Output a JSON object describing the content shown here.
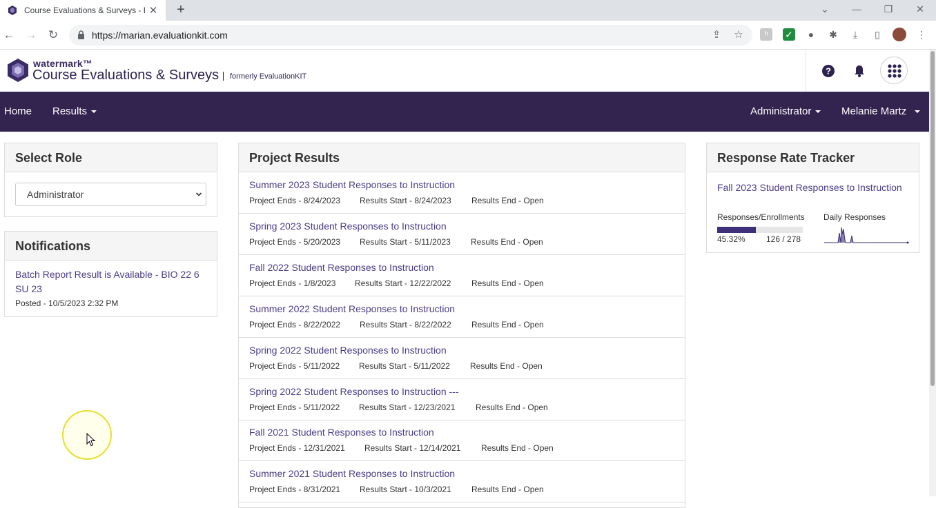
{
  "browser": {
    "tab_title": "Course Evaluations & Surveys - E",
    "tab_close": "✕",
    "new_tab": "+",
    "url": "https://marian.evaluationkit.com"
  },
  "header": {
    "brand_small": "watermark™",
    "brand_big": "Course Evaluations & Surveys",
    "formerly": "formerly EvaluationKIT"
  },
  "nav": {
    "home": "Home",
    "results": "Results",
    "administrator": "Administrator",
    "user": "Melanie Martz"
  },
  "select_role": {
    "title": "Select Role",
    "selected": "Administrator"
  },
  "notifications": {
    "title": "Notifications",
    "items": [
      {
        "link": "Batch Report Result is Available - BIO 22 6 SU 23",
        "posted": "Posted - 10/5/2023 2:32 PM"
      }
    ]
  },
  "project_results": {
    "title": "Project Results",
    "rows": [
      {
        "title": "Summer 2023 Student Responses to Instruction",
        "ends": "Project Ends - 8/24/2023",
        "start": "Results Start - 8/24/2023",
        "end": "Results End - Open"
      },
      {
        "title": "Spring 2023 Student Responses to Instruction",
        "ends": "Project Ends - 5/20/2023",
        "start": "Results Start - 5/11/2023",
        "end": "Results End - Open"
      },
      {
        "title": "Fall 2022 Student Responses to Instruction",
        "ends": "Project Ends - 1/8/2023",
        "start": "Results Start - 12/22/2022",
        "end": "Results End - Open"
      },
      {
        "title": "Summer 2022 Student Responses to Instruction",
        "ends": "Project Ends - 8/22/2022",
        "start": "Results Start - 8/22/2022",
        "end": "Results End - Open"
      },
      {
        "title": "Spring 2022 Student Responses to Instruction",
        "ends": "Project Ends - 5/11/2022",
        "start": "Results Start - 5/11/2022",
        "end": "Results End - Open"
      },
      {
        "title": "Spring 2022 Student Responses to Instruction ---",
        "ends": "Project Ends - 5/11/2022",
        "start": "Results Start - 12/23/2021",
        "end": "Results End - Open"
      },
      {
        "title": "Fall 2021 Student Responses to Instruction",
        "ends": "Project Ends - 12/31/2021",
        "start": "Results Start - 12/14/2021",
        "end": "Results End - Open"
      },
      {
        "title": "Summer 2021 Student Responses to Instruction",
        "ends": "Project Ends - 8/31/2021",
        "start": "Results Start - 10/3/2021",
        "end": "Results End - Open"
      }
    ]
  },
  "response_rate": {
    "title": "Response Rate Tracker",
    "project": "Fall 2023 Student Responses to Instruction",
    "label_enrollments": "Responses/Enrollments",
    "label_daily": "Daily Responses",
    "percent": "45.32%",
    "fraction": 0.4532,
    "counts": "126 / 278"
  },
  "colors": {
    "nav_bg": "#33234f",
    "link": "#4a3d87",
    "progress": "#3e2f78"
  }
}
